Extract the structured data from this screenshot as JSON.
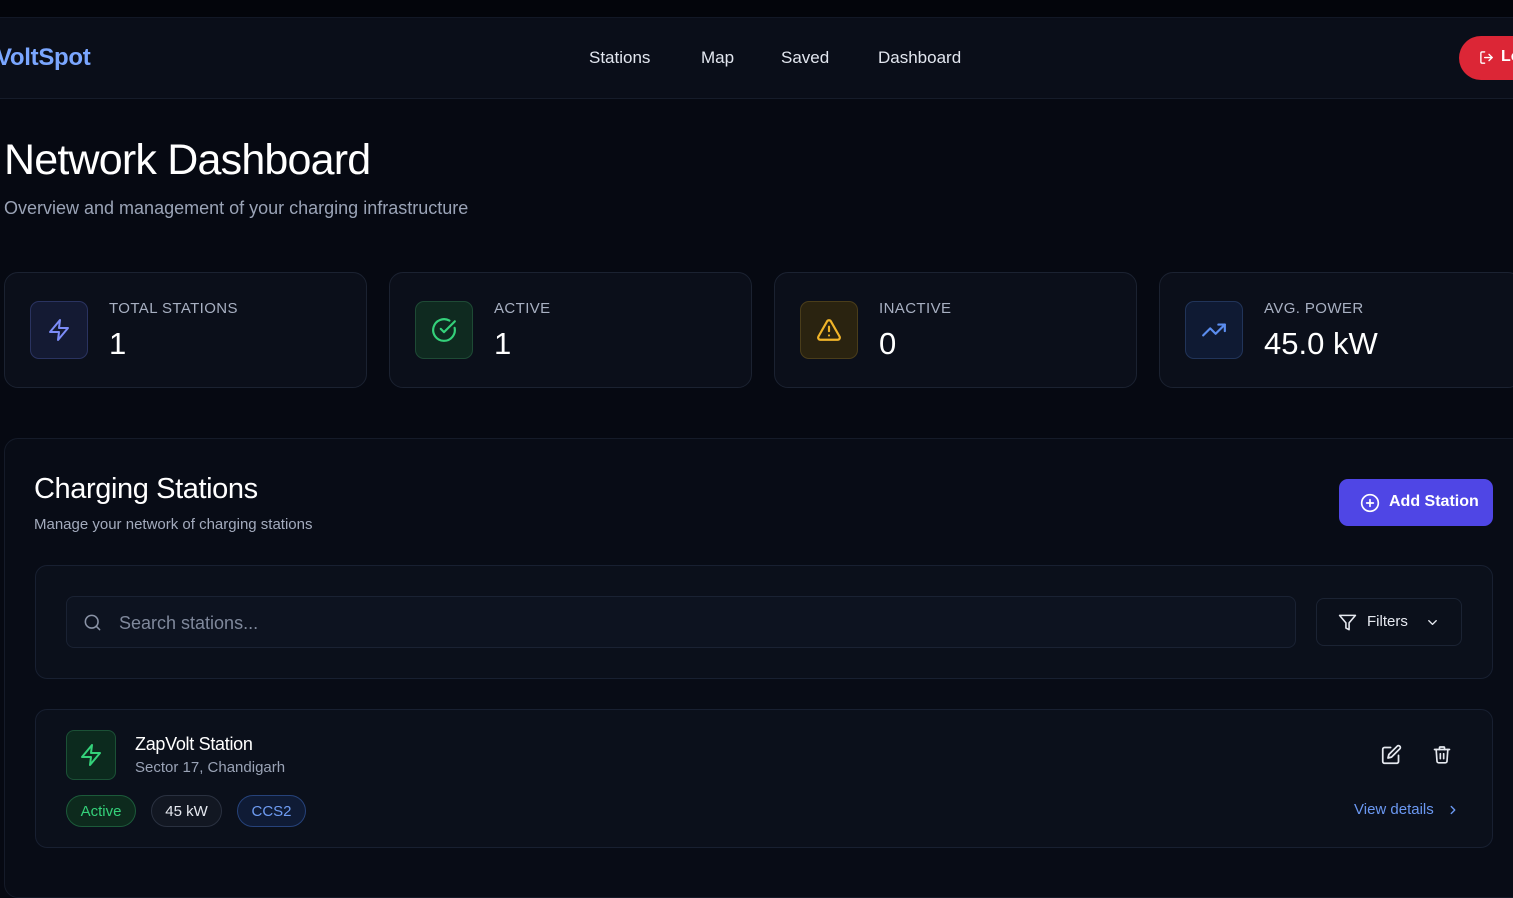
{
  "app": {
    "brand": "VoltSpot"
  },
  "nav": {
    "links": [
      {
        "label": "Stations"
      },
      {
        "label": "Map"
      },
      {
        "label": "Saved"
      },
      {
        "label": "Dashboard"
      }
    ],
    "logout_label": "Lo"
  },
  "header": {
    "title": "Network Dashboard",
    "subtitle": "Overview and management of your charging infrastructure"
  },
  "stats": [
    {
      "label": "TOTAL STATIONS",
      "value": "1",
      "icon": "bolt-icon",
      "color": "#7c8cf8"
    },
    {
      "label": "ACTIVE",
      "value": "1",
      "icon": "check-circle-icon",
      "color": "#34d17a"
    },
    {
      "label": "INACTIVE",
      "value": "0",
      "icon": "warning-icon",
      "color": "#f0b429"
    },
    {
      "label": "AVG. POWER",
      "value": "45.0 kW",
      "icon": "trending-up-icon",
      "color": "#5b8def"
    }
  ],
  "stations_panel": {
    "title": "Charging Stations",
    "subtitle": "Manage your network of charging stations",
    "add_button": "Add Station",
    "search_placeholder": "Search stations...",
    "filters_label": "Filters"
  },
  "stations": [
    {
      "name": "ZapVolt Station",
      "location": "Sector 17, Chandigarh",
      "status": "Active",
      "power": "45 kW",
      "connector": "CCS2",
      "view_label": "View details"
    }
  ],
  "colors": {
    "background": "#060912",
    "accent": "#4f46e5",
    "danger": "#dc2636",
    "success": "#34d17a",
    "link": "#6b98f2"
  }
}
